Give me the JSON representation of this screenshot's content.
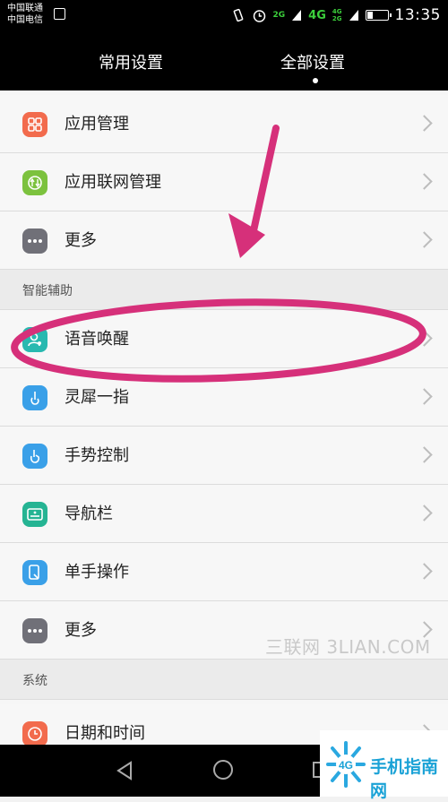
{
  "status_bar": {
    "carrier1": "中国联通",
    "carrier2": "中国电信",
    "signal1": "2G",
    "signal2": "4G",
    "signal3_top": "4G",
    "signal3_bottom": "2G",
    "time": "13:35",
    "battery_level": 0.3
  },
  "tabs": [
    {
      "label": "常用设置",
      "selected": false
    },
    {
      "label": "全部设置",
      "selected": true
    }
  ],
  "rows_top": [
    {
      "label": "应用管理",
      "icon": "app-grid-icon",
      "color": "#f26b4d"
    },
    {
      "label": "应用联网管理",
      "icon": "network-icon",
      "color": "#7cc23e"
    },
    {
      "label": "更多",
      "icon": "more-dots-icon",
      "color": "#707078"
    }
  ],
  "section_assist": "智能辅助",
  "rows_assist": [
    {
      "label": "语音唤醒",
      "icon": "voice-user-icon",
      "color": "#28b9b0"
    },
    {
      "label": "灵犀一指",
      "icon": "knuckle-icon",
      "color": "#3aa0e8"
    },
    {
      "label": "手势控制",
      "icon": "gesture-icon",
      "color": "#3aa0e8"
    },
    {
      "label": "导航栏",
      "icon": "navbar-icon",
      "color": "#25b493"
    },
    {
      "label": "单手操作",
      "icon": "one-hand-icon",
      "color": "#3aa0e8"
    },
    {
      "label": "更多",
      "icon": "more-dots-icon",
      "color": "#707078"
    }
  ],
  "section_system": "系统",
  "rows_system": [
    {
      "label": "日期和时间",
      "icon": "clock-icon",
      "color": "#f26b4d"
    }
  ],
  "watermark": "三联网 3LIAN.COM",
  "logo_text": "手机指南网",
  "logo_badge": "4G",
  "colors": {
    "annotation": "#d6307a",
    "accent": "#1aa2d6"
  }
}
